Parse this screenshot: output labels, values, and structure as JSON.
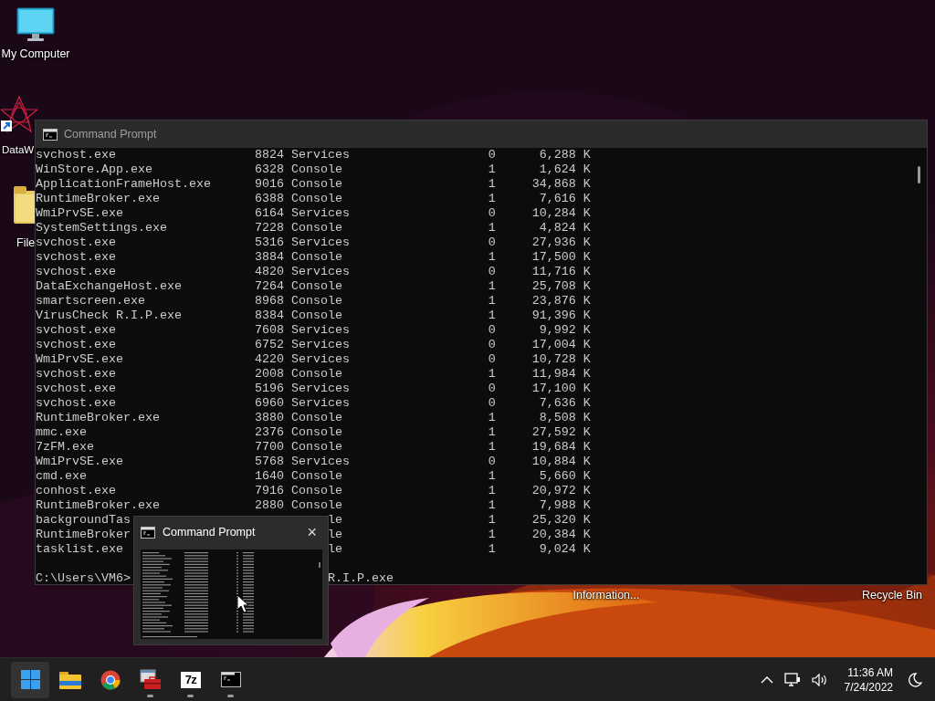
{
  "desktop_icons": [
    {
      "kind": "computer",
      "label": "My Computer"
    },
    {
      "kind": "shortcut",
      "label": "DataW"
    },
    {
      "kind": "folder",
      "label": "File"
    },
    {
      "kind": "hidden",
      "label": "Information..."
    },
    {
      "kind": "hidden",
      "label": "Recycle Bin"
    }
  ],
  "console": {
    "title": "Command Prompt",
    "rows": [
      {
        "kind": "full",
        "name": "svchost.exe",
        "pid": "8824",
        "session_name": "Services",
        "session_number": "0",
        "memory": "6,288 K"
      },
      {
        "kind": "full",
        "name": "WinStore.App.exe",
        "pid": "6328",
        "session_name": "Console",
        "session_number": "1",
        "memory": "1,624 K"
      },
      {
        "kind": "full",
        "name": "ApplicationFrameHost.exe",
        "pid": "9016",
        "session_name": "Console",
        "session_number": "1",
        "memory": "34,868 K"
      },
      {
        "kind": "full",
        "name": "RuntimeBroker.exe",
        "pid": "6388",
        "session_name": "Console",
        "session_number": "1",
        "memory": "7,616 K"
      },
      {
        "kind": "full",
        "name": "WmiPrvSE.exe",
        "pid": "6164",
        "session_name": "Services",
        "session_number": "0",
        "memory": "10,284 K"
      },
      {
        "kind": "full",
        "name": "SystemSettings.exe",
        "pid": "7228",
        "session_name": "Console",
        "session_number": "1",
        "memory": "4,824 K"
      },
      {
        "kind": "full",
        "name": "svchost.exe",
        "pid": "5316",
        "session_name": "Services",
        "session_number": "0",
        "memory": "27,936 K"
      },
      {
        "kind": "full",
        "name": "svchost.exe",
        "pid": "3884",
        "session_name": "Console",
        "session_number": "1",
        "memory": "17,500 K"
      },
      {
        "kind": "full",
        "name": "svchost.exe",
        "pid": "4820",
        "session_name": "Services",
        "session_number": "0",
        "memory": "11,716 K"
      },
      {
        "kind": "full",
        "name": "DataExchangeHost.exe",
        "pid": "7264",
        "session_name": "Console",
        "session_number": "1",
        "memory": "25,708 K"
      },
      {
        "kind": "full",
        "name": "smartscreen.exe",
        "pid": "8968",
        "session_name": "Console",
        "session_number": "1",
        "memory": "23,876 K"
      },
      {
        "kind": "full",
        "name": "VirusCheck R.I.P.exe",
        "pid": "8384",
        "session_name": "Console",
        "session_number": "1",
        "memory": "91,396 K"
      },
      {
        "kind": "full",
        "name": "svchost.exe",
        "pid": "7608",
        "session_name": "Services",
        "session_number": "0",
        "memory": "9,992 K"
      },
      {
        "kind": "full",
        "name": "svchost.exe",
        "pid": "6752",
        "session_name": "Services",
        "session_number": "0",
        "memory": "17,004 K"
      },
      {
        "kind": "full",
        "name": "WmiPrvSE.exe",
        "pid": "4220",
        "session_name": "Services",
        "session_number": "0",
        "memory": "10,728 K"
      },
      {
        "kind": "full",
        "name": "svchost.exe",
        "pid": "2008",
        "session_name": "Console",
        "session_number": "1",
        "memory": "11,984 K"
      },
      {
        "kind": "full",
        "name": "svchost.exe",
        "pid": "5196",
        "session_name": "Services",
        "session_number": "0",
        "memory": "17,100 K"
      },
      {
        "kind": "full",
        "name": "svchost.exe",
        "pid": "6960",
        "session_name": "Services",
        "session_number": "0",
        "memory": "7,636 K"
      },
      {
        "kind": "full",
        "name": "RuntimeBroker.exe",
        "pid": "3880",
        "session_name": "Console",
        "session_number": "1",
        "memory": "8,508 K"
      },
      {
        "kind": "full",
        "name": "mmc.exe",
        "pid": "2376",
        "session_name": "Console",
        "session_number": "1",
        "memory": "27,592 K"
      },
      {
        "kind": "full",
        "name": "7zFM.exe",
        "pid": "7700",
        "session_name": "Console",
        "session_number": "1",
        "memory": "19,684 K"
      },
      {
        "kind": "full",
        "name": "WmiPrvSE.exe",
        "pid": "5768",
        "session_name": "Services",
        "session_number": "0",
        "memory": "10,884 K"
      },
      {
        "kind": "full",
        "name": "cmd.exe",
        "pid": "1640",
        "session_name": "Console",
        "session_number": "1",
        "memory": "5,660 K"
      },
      {
        "kind": "full",
        "name": "conhost.exe",
        "pid": "7916",
        "session_name": "Console",
        "session_number": "1",
        "memory": "20,972 K"
      },
      {
        "kind": "full",
        "name": "RuntimeBroker.exe",
        "pid": "2880",
        "session_name": "Console",
        "session_number": "1",
        "memory": "7,988 K"
      },
      {
        "kind": "partial",
        "name": "backgroundTas",
        "session_name": "le",
        "session_number": "1",
        "memory": "25,320 K"
      },
      {
        "kind": "partial",
        "name": "RuntimeBroker",
        "session_name": "le",
        "session_number": "1",
        "memory": "20,384 K"
      },
      {
        "kind": "partial",
        "name": "tasklist.exe",
        "session_name": "le",
        "session_number": "1",
        "memory": "9,024 K"
      }
    ],
    "prompt": "C:\\Users\\VM6>",
    "command_tail": "R.I.P.exe"
  },
  "thumbnail": {
    "title": "Command Prompt",
    "close": "×"
  },
  "taskbar": {
    "apps": [
      {
        "kind": "start",
        "highlighted": true,
        "running": false
      },
      {
        "kind": "folder",
        "highlighted": false,
        "running": false
      },
      {
        "kind": "browser",
        "highlighted": false,
        "running": false
      },
      {
        "kind": "toolbox",
        "highlighted": false,
        "running": true
      },
      {
        "kind": "archiver",
        "label": "7z",
        "highlighted": false,
        "running": true
      },
      {
        "kind": "terminal",
        "highlighted": false,
        "running": true
      }
    ],
    "time": "11:36 AM",
    "date": "7/24/2022"
  }
}
